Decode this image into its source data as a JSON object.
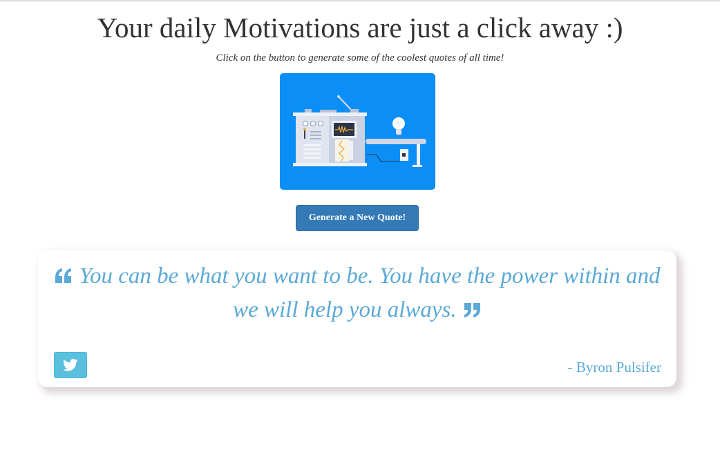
{
  "header": {
    "title": "Your daily Motivations are just a click away :)",
    "subtitle": "Click on the button to generate some of the coolest quotes of all time!"
  },
  "illustration": {
    "icon": "quote-machine-illustration",
    "background": "#0b8ff6"
  },
  "generate_button": {
    "label": "Generate a New Quote!"
  },
  "quote": {
    "text": "You can be what you want to be. You have the power within and we will help you always.",
    "author": "- Byron Pulsifer",
    "open_icon": "quote-left-icon",
    "close_icon": "quote-right-icon"
  },
  "tweet_button": {
    "icon": "twitter-icon"
  },
  "colors": {
    "accent": "#337ab7",
    "quote": "#5aa9d6",
    "tweet": "#5bc0de"
  }
}
